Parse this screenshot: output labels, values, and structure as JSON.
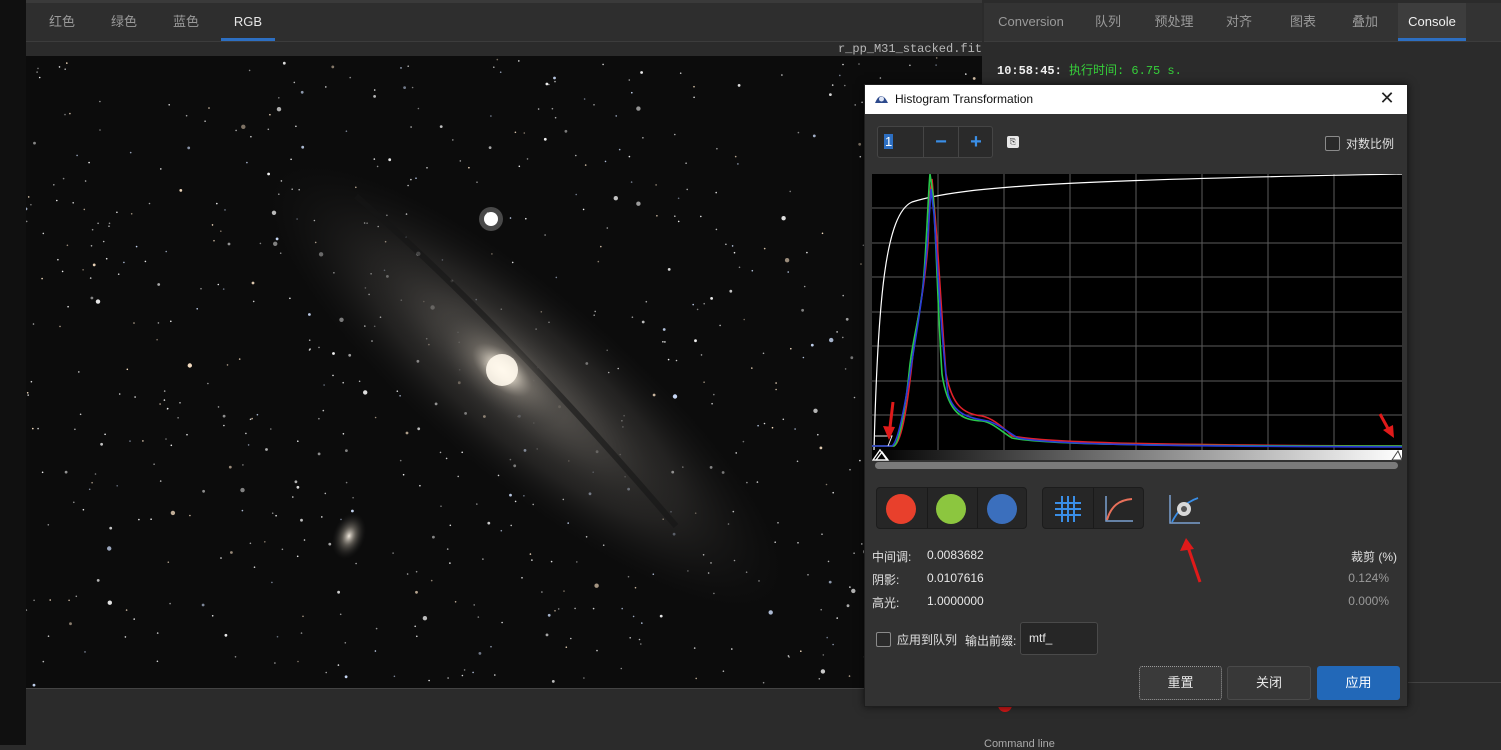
{
  "viewer": {
    "tabs": [
      "红色",
      "绿色",
      "蓝色",
      "RGB"
    ],
    "active_tab": "RGB",
    "filename": "r_pp_M31_stacked.fit"
  },
  "right_panel": {
    "tabs": [
      "Conversion",
      "队列",
      "预处理",
      "对齐",
      "图表",
      "叠加",
      "Console"
    ],
    "active_tab": "Console",
    "console_lines": [
      {
        "time": "10:58:45:",
        "text": "执行时间: 6.75 s.",
        "color": "#36d03a"
      }
    ],
    "bottom_label": "Command line"
  },
  "dialog": {
    "title": "Histogram Transformation",
    "close_icon": "close-icon",
    "spin_value": "1",
    "spin_minus": "−",
    "spin_plus": "+",
    "log_scale_label": "对数比例",
    "channel_colors": {
      "red": "#e8402c",
      "green": "#8cc63f",
      "blue": "#3b6fbd"
    },
    "midtones_label": "中间调:",
    "midtones_value": "0.0083682",
    "shadows_label": "阴影:",
    "shadows_value": "0.0107616",
    "highlights_label": "高光:",
    "highlights_value": "1.0000000",
    "clip_header": "裁剪 (%)",
    "shadows_clip": "0.124%",
    "highlights_clip": "0.000%",
    "apply_seq_label": "应用到队列",
    "prefix_label": "输出前缀:",
    "prefix_value": "mtf_",
    "reset_label": "重置",
    "close_label": "关闭",
    "apply_label": "应用",
    "accent": "#2268b8"
  }
}
